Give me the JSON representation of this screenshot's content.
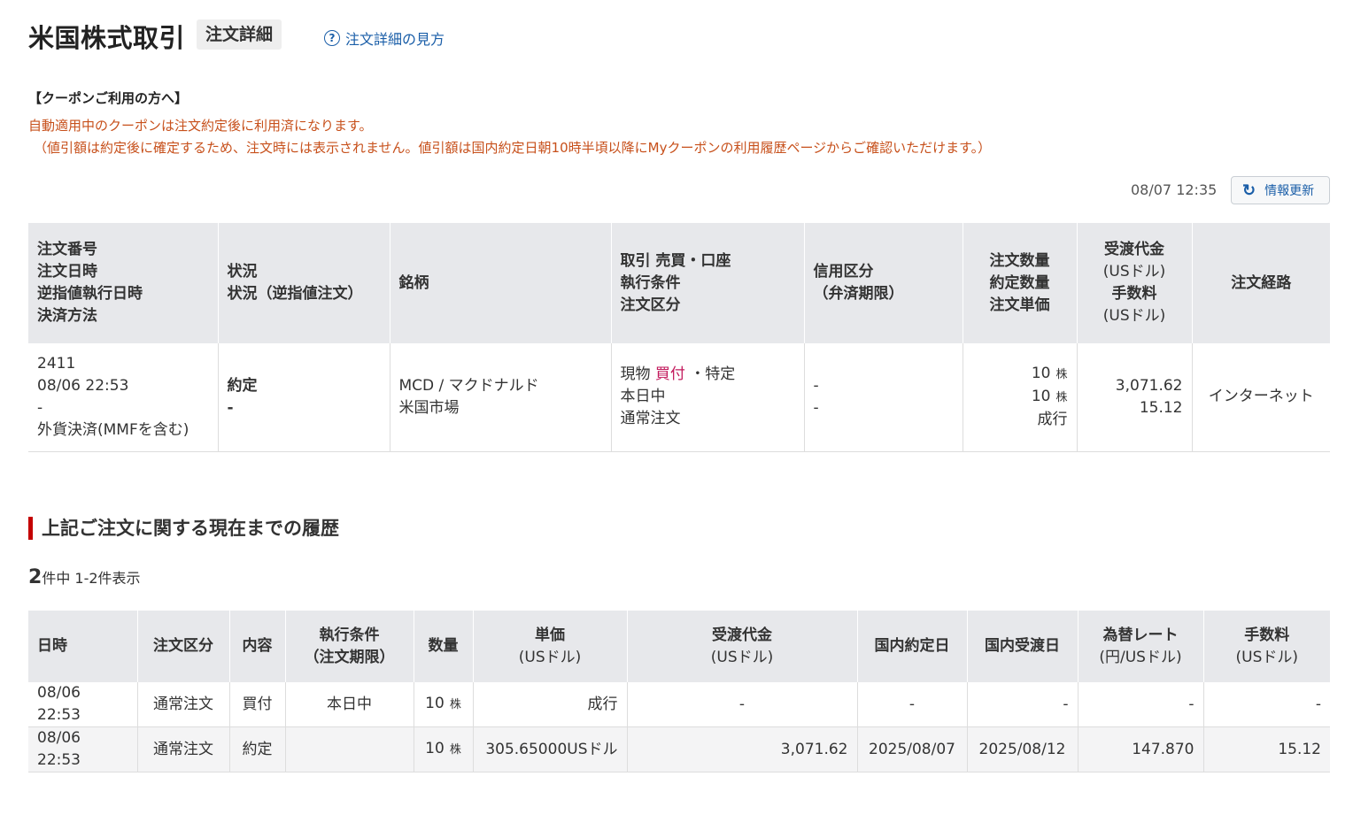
{
  "page": {
    "title": "米国株式取引",
    "subtitle": "注文詳細",
    "help_icon": "question-circle-icon",
    "help_link": "注文詳細の見方"
  },
  "coupon": {
    "heading": "【クーポンご利用の方へ】",
    "line1": "自動適用中のクーポンは注文約定後に利用済になります。",
    "line2": "（値引額は約定後に確定するため、注文時には表示されません。値引額は国内約定日朝10時半頃以降にMyクーポンの利用履歴ページからご確認いただけます。）"
  },
  "status_bar": {
    "timestamp": "08/07 12:35",
    "refresh_icon": "refresh-icon",
    "refresh_label": "情報更新"
  },
  "order_table": {
    "headers": {
      "col1": [
        "注文番号",
        "注文日時",
        "逆指値執行日時",
        "決済方法"
      ],
      "col2": [
        "状況",
        "状況（逆指値注文）"
      ],
      "col3": "銘柄",
      "col4": [
        "取引 売買・口座",
        "執行条件",
        "注文区分"
      ],
      "col5": [
        "信用区分",
        "（弁済期限）"
      ],
      "col6": [
        "注文数量",
        "約定数量",
        "注文単価"
      ],
      "col7": {
        "a": "受渡代金",
        "a_unit": "(USドル)",
        "b": "手数料",
        "b_unit": "(USドル)"
      },
      "col8": "注文経路"
    },
    "row": {
      "order_no": "2411",
      "order_datetime": "08/06 22:53",
      "stop_datetime": "-",
      "settlement": "外貨決済(MMFを含む)",
      "status": "約定",
      "status_stop": "-",
      "symbol": "MCD / マクドナルド",
      "market": "米国市場",
      "trade_type": "現物",
      "side": "買付",
      "account": "・特定",
      "condition": "本日中",
      "order_type": "通常注文",
      "margin": "-",
      "margin_deadline": "-",
      "order_qty": "10",
      "exec_qty": "10",
      "qty_unit": "株",
      "price": "成行",
      "amount": "3,071.62",
      "fee": "15.12",
      "route": "インターネット"
    }
  },
  "history": {
    "title": "上記ご注文に関する現在までの履歴",
    "count_total": "2",
    "count_suffix": "件中 1-2件表示",
    "headers": {
      "date": "日時",
      "order_type": "注文区分",
      "content": "内容",
      "condition": "執行条件",
      "condition_sub": "（注文期限）",
      "qty": "数量",
      "price": "単価",
      "price_unit": "(USドル)",
      "amount": "受渡代金",
      "amount_unit": "(USドル)",
      "domestic_exec": "国内約定日",
      "domestic_settle": "国内受渡日",
      "fx": "為替レート",
      "fx_unit": "(円/USドル)",
      "fee": "手数料",
      "fee_unit": "(USドル)"
    },
    "rows": [
      {
        "date": "08/06 22:53",
        "order_type": "通常注文",
        "content": "買付",
        "condition": "本日中",
        "qty": "10",
        "unit": "株",
        "price": "成行",
        "amount": "-",
        "domestic_exec": "-",
        "domestic_settle": "-",
        "fx": "-",
        "fee": "-"
      },
      {
        "date": "08/06 22:53",
        "order_type": "通常注文",
        "content": "約定",
        "condition": "",
        "qty": "10",
        "unit": "株",
        "price": "305.65000USドル",
        "amount": "3,071.62",
        "domestic_exec": "2025/08/07",
        "domestic_settle": "2025/08/12",
        "fx": "147.870",
        "fee": "15.12"
      }
    ]
  }
}
